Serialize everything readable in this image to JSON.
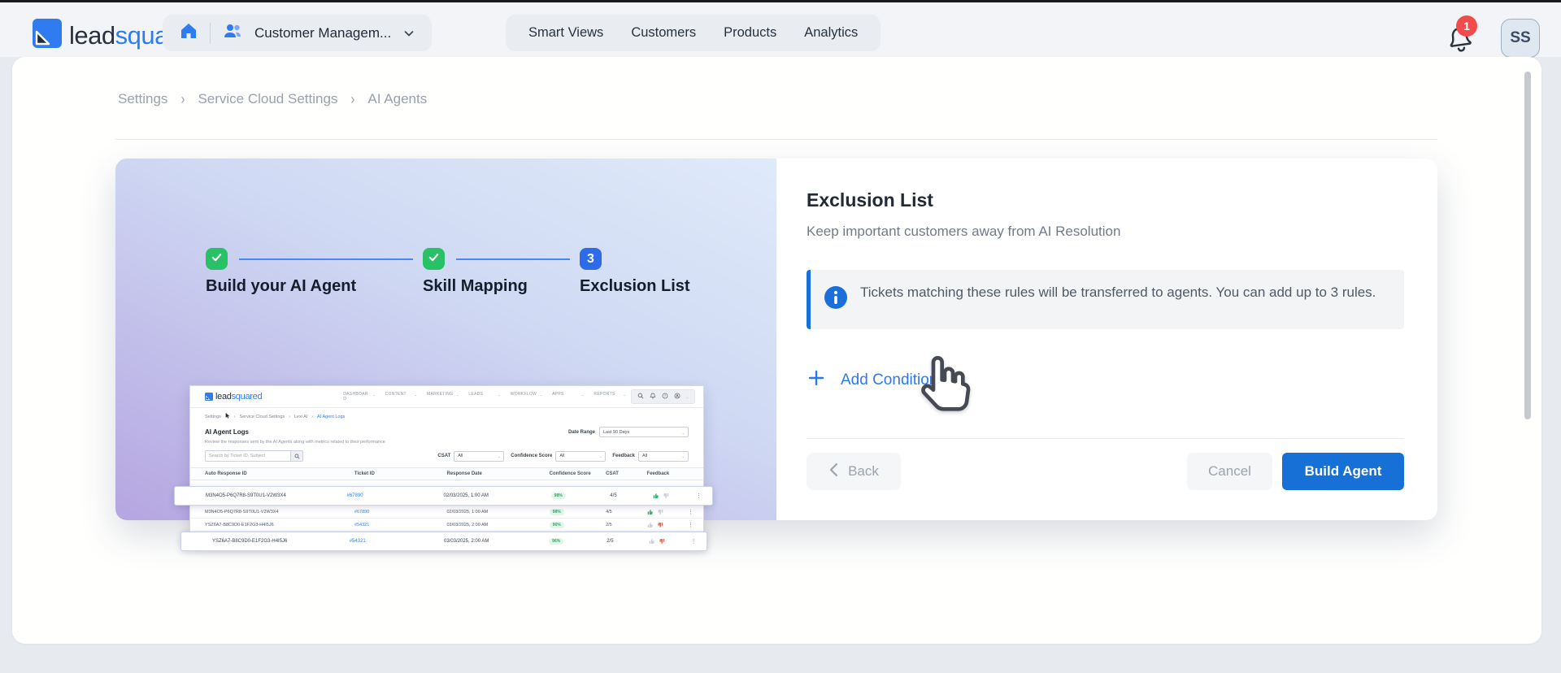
{
  "topbar": {
    "logo": {
      "lead": "lead",
      "squared": "squared"
    },
    "workspace_label": "Customer Managem...",
    "nav_items": [
      "Smart Views",
      "Customers",
      "Products",
      "Analytics"
    ],
    "notification_count": "1",
    "avatar_initials": "SS"
  },
  "breadcrumb": {
    "items": [
      "Settings",
      "Service Cloud Settings",
      "AI Agents"
    ]
  },
  "wizard": {
    "steps": [
      {
        "label": "Build your AI Agent",
        "state": "done"
      },
      {
        "label": "Skill Mapping",
        "state": "done"
      },
      {
        "label": "Exclusion List",
        "state": "active",
        "number": "3"
      }
    ]
  },
  "panel": {
    "title": "Exclusion List",
    "subtitle": "Keep important customers away from AI Resolution",
    "info_text": "Tickets matching these rules will be transferred to agents. You can add up to 3 rules.",
    "add_conditions_label": "Add Conditions",
    "back_label": "Back",
    "cancel_label": "Cancel",
    "build_label": "Build Agent"
  },
  "preview": {
    "logo": {
      "lead": "lead",
      "squared": "squared"
    },
    "nav": [
      "DASHBOARD",
      "CONTENT",
      "MARKETING",
      "LEADS",
      "WORKFLOW",
      "APPS",
      "REPORTS"
    ],
    "breadcrumb": [
      "Settings",
      "Service Cloud Settings",
      "Lexi AI",
      "AI Agent Logs"
    ],
    "title": "AI Agent Logs",
    "subtitle": "Review the responses sent by the AI Agents along with metrics related to their performance",
    "date_range_label": "Date Range",
    "date_range_value": "Last 90 Days",
    "search_placeholder": "Search by Ticket ID, Subject",
    "filters": [
      {
        "label": "CSAT",
        "value": "All"
      },
      {
        "label": "Confidence Score",
        "value": "All"
      },
      {
        "label": "Feedback",
        "value": "All"
      }
    ],
    "table": {
      "headers": [
        "Auto Response ID",
        "Ticket ID",
        "Response Date",
        "Confidence Score",
        "CSAT",
        "Feedback"
      ],
      "rows": [
        {
          "auto_response_id": "M3N4O5-P6Q7R8-S9T0U1-V2W3X4",
          "ticket_id": "#67890",
          "response_date": "02/03/2025, 1:00 AM",
          "confidence": "98%",
          "csat": "4/5",
          "feedback": "up",
          "popped": true
        },
        {
          "auto_response_id": "M3N4O5-P6Q7R8-S9T0U1-V2W3X4",
          "ticket_id": "#67890",
          "response_date": "02/03/2025, 1:00 AM",
          "confidence": "98%",
          "csat": "4/5",
          "feedback": "up",
          "popped": false
        },
        {
          "auto_response_id": "YSZ6A7-B8C9D0-E1F2G3-H4I5J6",
          "ticket_id": "#54321",
          "response_date": "03/03/2025, 2:00 AM",
          "confidence": "96%",
          "csat": "2/5",
          "feedback": "down",
          "popped": false
        },
        {
          "auto_response_id": "YSZ6A7-B8C9D0-E1F2G3-H4I5J6",
          "ticket_id": "#54321",
          "response_date": "03/03/2025, 2:00 AM",
          "confidence": "96%",
          "csat": "2/5",
          "feedback": "down",
          "popped": true
        }
      ]
    }
  },
  "colors": {
    "brand_blue": "#2e7cf0",
    "primary_button": "#1670d6",
    "step_done_green": "#29c165",
    "step_active_blue": "#2d6be8",
    "info_accent": "#1b6fd8",
    "badge_red": "#f14b4b",
    "link_blue": "#2979f2"
  }
}
